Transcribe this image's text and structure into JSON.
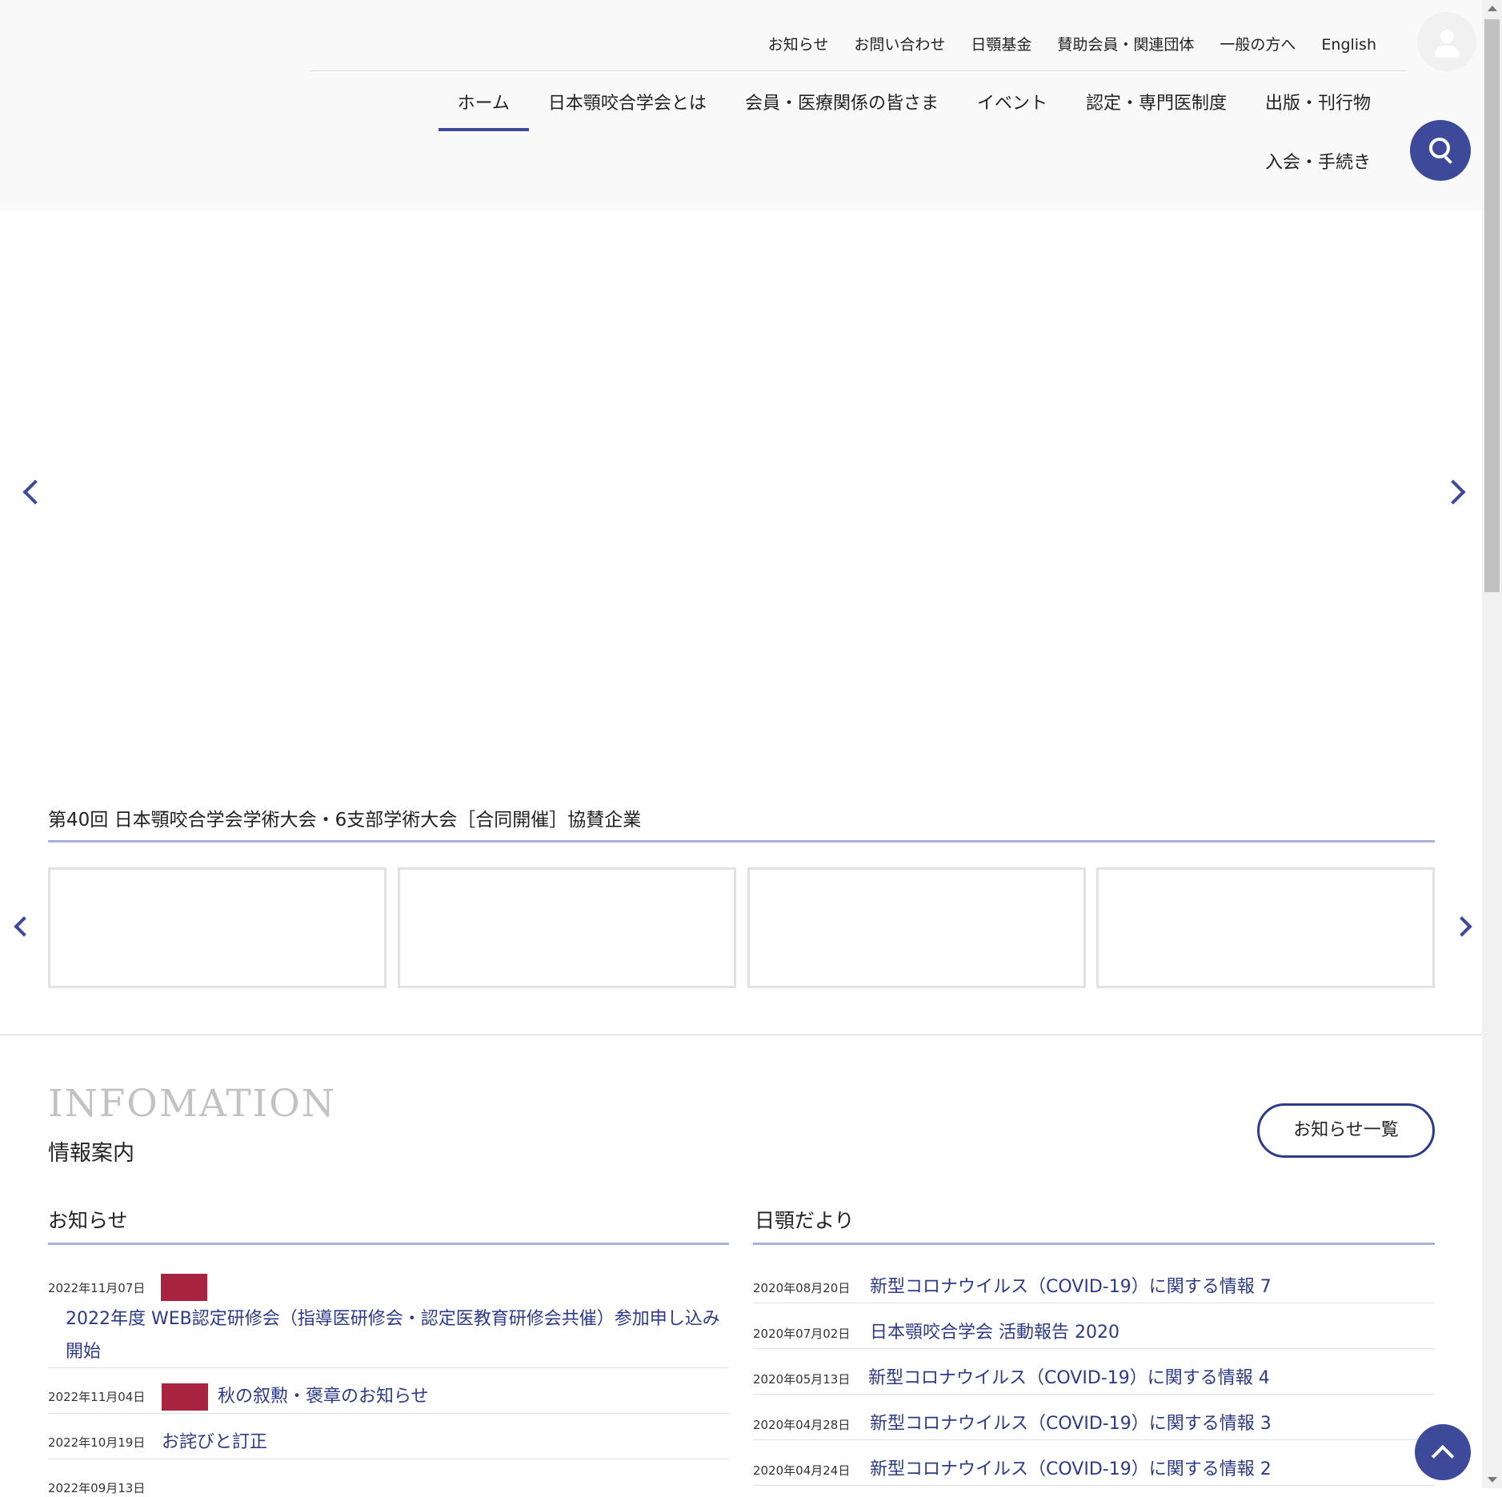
{
  "header": {
    "util_nav": [
      "お知らせ",
      "お問い合わせ",
      "日顎基金",
      "賛助会員・関連団体",
      "一般の方へ",
      "English"
    ],
    "main_nav": [
      "ホーム",
      "日本顎咬合学会とは",
      "会員・医療関係の皆さま",
      "イベント",
      "認定・専門医制度",
      "出版・刊行物"
    ],
    "main_nav_row2": "入会・手続き",
    "active_index": 0
  },
  "icons": {
    "user": "user-icon",
    "search": "search-icon",
    "prev": "chevron-left-icon",
    "next": "chevron-right-icon",
    "to_top": "chevron-up-icon"
  },
  "sponsor": {
    "title": "第40回 日本顎咬合学会学術大会・6支部学術大会［合同開催］協賛企業"
  },
  "info": {
    "heading_en": "INFOMATION",
    "heading_ja": "情報案内",
    "list_button": "お知らせ一覧",
    "news_title": "お知らせ",
    "news": [
      {
        "date": "2022年11月07日",
        "title": "2022年度 WEB認定研修会（指導医研修会・認定医教育研修会共催）参加申し込み",
        "title_line2": "開始"
      },
      {
        "date": "2022年11月04日",
        "title": "秋の叙勲・褒章のお知らせ"
      },
      {
        "date": "2022年10月19日",
        "title": "お詫びと訂正"
      },
      {
        "date": "2022年09月13日",
        "title": ""
      }
    ],
    "dayori_title": "日顎だより",
    "dayori": [
      {
        "date": "2020年08月20日",
        "title": "新型コロナウイルス（COVID-19）に関する情報 7"
      },
      {
        "date": "2020年07月02日",
        "title": "日本顎咬合学会 活動報告 2020"
      },
      {
        "date": "2020年05月13日",
        "title": "新型コロナウイルス（COVID-19）に関する情報 4"
      },
      {
        "date": "2020年04月28日",
        "title": "新型コロナウイルス（COVID-19）に関する情報 3"
      },
      {
        "date": "2020年04月24日",
        "title": "新型コロナウイルス（COVID-19）に関する情報 2"
      }
    ]
  },
  "colors": {
    "brand": "#3d4a99",
    "link": "#2c3a8a",
    "badge": "#a8233f",
    "underline": "#a7b1de"
  }
}
